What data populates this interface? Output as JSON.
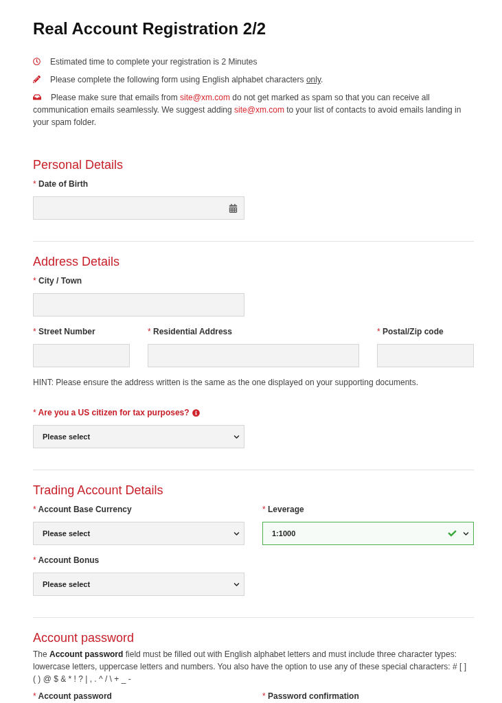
{
  "title": "Real Account Registration 2/2",
  "notices": [
    {
      "kind": "duration",
      "parts": [
        {
          "kind": "text",
          "text": "Estimated time to complete your registration is 2 Minutes"
        }
      ]
    },
    {
      "kind": "alphabet",
      "parts": [
        {
          "kind": "text",
          "text": "Please complete the following form using English alphabet characters "
        },
        {
          "kind": "underline",
          "text": "only"
        },
        {
          "kind": "text",
          "text": "."
        }
      ]
    },
    {
      "kind": "email",
      "parts": [
        {
          "kind": "text",
          "text": "Please make sure that emails from "
        },
        {
          "kind": "link",
          "text": "site@xm.com"
        },
        {
          "kind": "text",
          "text": " do not get marked as spam so that you can receive all communication emails seamlessly. We suggest adding "
        },
        {
          "kind": "link",
          "text": "site@xm.com"
        },
        {
          "kind": "text",
          "text": " to your list of contacts to avoid emails landing in your spam folder."
        }
      ]
    }
  ],
  "sections": [
    {
      "heading": "Personal Details",
      "blocks": [
        {
          "kind": "fields",
          "fields": [
            {
              "kind": "date",
              "marker": "*",
              "label": "Date of Birth",
              "highlighted": false,
              "info": false,
              "valid": false
            }
          ]
        }
      ]
    },
    {
      "heading": "Address Details",
      "blocks": [
        {
          "kind": "fields",
          "fields": [
            {
              "kind": "text",
              "marker": "*",
              "label": "City / Town",
              "highlighted": false,
              "info": false,
              "valid": false
            }
          ]
        },
        {
          "kind": "fields",
          "fields": [
            {
              "kind": "text",
              "marker": "*",
              "label": "Street Number",
              "highlighted": false,
              "info": false,
              "valid": false
            },
            {
              "kind": "text",
              "marker": "*",
              "label": "Residential Address",
              "highlighted": false,
              "info": false,
              "valid": false
            },
            {
              "kind": "text",
              "marker": "*",
              "label": "Postal/Zip code",
              "highlighted": false,
              "info": false,
              "valid": false
            }
          ]
        },
        {
          "kind": "hint",
          "parts": [
            {
              "kind": "text",
              "text": "HINT: Please ensure the address written is the same as the one displayed on your supporting documents."
            }
          ]
        },
        {
          "kind": "fields",
          "fields": [
            {
              "kind": "select",
              "marker": "*",
              "label": "Are you a US citizen for tax purposes?",
              "value": "Please select",
              "highlighted": true,
              "info": true,
              "valid": false
            }
          ]
        }
      ]
    },
    {
      "heading": "Trading Account Details",
      "blocks": [
        {
          "kind": "fields",
          "fields": [
            {
              "kind": "select",
              "marker": "*",
              "label": "Account Base Currency",
              "value": "Please select",
              "highlighted": false,
              "info": false,
              "valid": false
            },
            {
              "kind": "select",
              "marker": "*",
              "label": "Leverage",
              "value": "1:1000",
              "highlighted": false,
              "info": false,
              "valid": true
            }
          ]
        },
        {
          "kind": "fields",
          "fields": [
            {
              "kind": "select",
              "marker": "*",
              "label": "Account Bonus",
              "value": "Please select",
              "highlighted": false,
              "info": false,
              "valid": false
            }
          ]
        }
      ]
    },
    {
      "heading": "Account password",
      "blocks": [
        {
          "kind": "paragraph",
          "parts": [
            {
              "kind": "text",
              "text": "The "
            },
            {
              "kind": "bold",
              "text": "Account password"
            },
            {
              "kind": "text",
              "text": " field must be filled out with English alphabet letters and must include three character types: lowercase letters, uppercase letters and numbers. You also have the option to use any of these special characters: # [ ] ( ) @ $ & * ! ? | , . ^ / \\ + _ -"
            }
          ]
        },
        {
          "kind": "fields",
          "fields": [
            {
              "marker": "*",
              "label": "Account password",
              "highlighted": false,
              "info": false
            },
            {
              "marker": "*",
              "label": "Password confirmation",
              "highlighted": false,
              "info": false
            }
          ]
        }
      ]
    }
  ]
}
